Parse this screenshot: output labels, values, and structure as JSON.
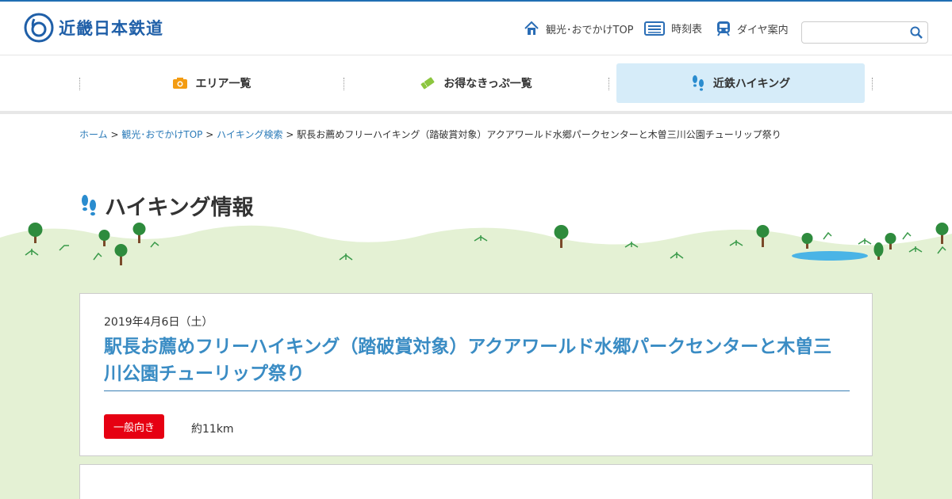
{
  "header": {
    "logo_text": "近畿日本鉄道",
    "links": [
      {
        "label": "観光･おでかけTOP",
        "icon": "home-icon"
      },
      {
        "label": "時刻表",
        "icon": "timetable-icon"
      },
      {
        "label": "ダイヤ案内",
        "icon": "train-icon"
      }
    ],
    "search": {
      "placeholder": ""
    }
  },
  "nav": {
    "items": [
      {
        "label": "エリア一覧",
        "icon": "camera-icon",
        "color": "#f39c12"
      },
      {
        "label": "お得なきっぷ一覧",
        "icon": "ticket-icon",
        "color": "#8cc63f"
      },
      {
        "label": "近鉄ハイキング",
        "icon": "footprints-icon",
        "color": "#2a8ccf",
        "active": true
      }
    ]
  },
  "breadcrumb": {
    "links": [
      "ホーム",
      "観光･おでかけTOP",
      "ハイキング検索"
    ],
    "separator": ">",
    "current": "駅長お薦めフリーハイキング（踏破賞対象）アクアワールド水郷パークセンターと木曽三川公園チューリップ祭り"
  },
  "page": {
    "heading": "ハイキング情報"
  },
  "event": {
    "date": "2019年4月6日（土）",
    "title": "駅長お薦めフリーハイキング（踏破賞対象）アクアワールド水郷パークセンターと木曽三川公園チューリップ祭り",
    "level_tag": "一般向き",
    "distance": "約11km"
  },
  "colors": {
    "brand": "#1f5fa8",
    "link": "#2a7ab8",
    "title": "#3a8cc4",
    "tag": "#e60012",
    "grass": "#e4f1d4"
  }
}
